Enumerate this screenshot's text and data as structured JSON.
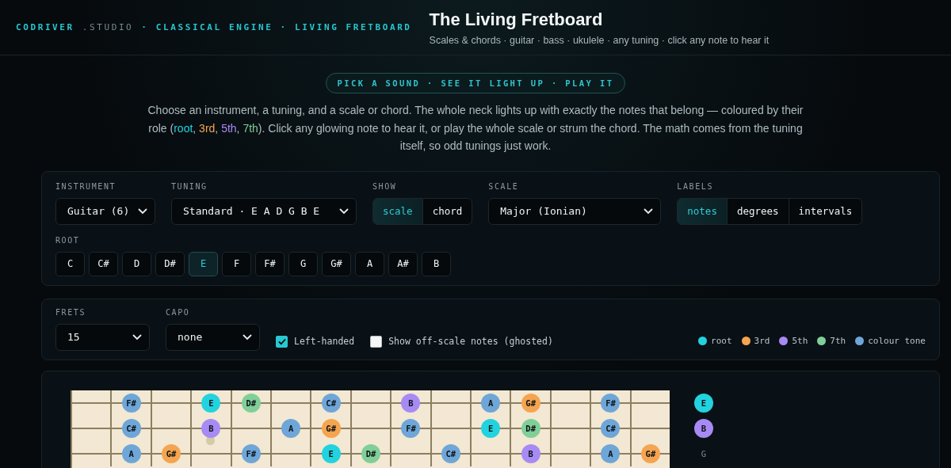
{
  "header": {
    "brand_parts": [
      {
        "text": "CODRIVER",
        "kind": "accent"
      },
      {
        "text": ".STUDIO",
        "kind": "muted"
      },
      {
        "text": "· CLASSICAL ENGINE · LIVING FRETBOARD",
        "kind": "accent"
      }
    ],
    "title": "The Living Fretboard",
    "subtitle": "Scales & chords · guitar · bass · ukulele · any tuning · click any note to hear it"
  },
  "pill": "PICK A SOUND · SEE IT LIGHT UP · PLAY IT",
  "intro": [
    {
      "text": "Choose an instrument, a tuning, and a scale or chord. The whole neck lights up with exactly the notes that belong — coloured by their role ("
    },
    {
      "text": "root",
      "color": "#22d3df"
    },
    {
      "text": ", "
    },
    {
      "text": "3rd",
      "color": "#f5a54f"
    },
    {
      "text": ", "
    },
    {
      "text": "5th",
      "color": "#a88af5"
    },
    {
      "text": ", "
    },
    {
      "text": "7th",
      "color": "#80cf98"
    },
    {
      "text": "). Click any glowing note to hear it, or play the whole scale or strum the chord. The math comes from the tuning itself, so odd tunings just work."
    }
  ],
  "controls": {
    "instrument": {
      "label": "INSTRUMENT",
      "value": "Guitar (6)"
    },
    "tuning": {
      "label": "TUNING",
      "value": "Standard · E A D G B E"
    },
    "show": {
      "label": "SHOW",
      "options": [
        {
          "label": "scale",
          "selected": true
        },
        {
          "label": "chord",
          "selected": false
        }
      ]
    },
    "scale": {
      "label": "SCALE",
      "value": "Major (Ionian)"
    },
    "labels": {
      "label": "LABELS",
      "options": [
        {
          "label": "notes",
          "selected": true
        },
        {
          "label": "degrees",
          "selected": false
        },
        {
          "label": "intervals",
          "selected": false
        }
      ]
    },
    "root": {
      "label": "ROOT",
      "options": [
        {
          "label": "C",
          "selected": false
        },
        {
          "label": "C#",
          "selected": false
        },
        {
          "label": "D",
          "selected": false
        },
        {
          "label": "D#",
          "selected": false
        },
        {
          "label": "E",
          "selected": true
        },
        {
          "label": "F",
          "selected": false
        },
        {
          "label": "F#",
          "selected": false
        },
        {
          "label": "G",
          "selected": false
        },
        {
          "label": "G#",
          "selected": false
        },
        {
          "label": "A",
          "selected": false
        },
        {
          "label": "A#",
          "selected": false
        },
        {
          "label": "B",
          "selected": false
        }
      ]
    }
  },
  "options": {
    "frets": {
      "label": "FRETS",
      "value": "15"
    },
    "capo": {
      "label": "CAPO",
      "value": "none"
    },
    "left_handed": {
      "label": "Left-handed",
      "checked": true
    },
    "show_off_scale": {
      "label": "Show off-scale notes (ghosted)",
      "checked": false
    },
    "legend": [
      {
        "label": "root",
        "color": "#22d3df"
      },
      {
        "label": "3rd",
        "color": "#f5a54f"
      },
      {
        "label": "5th",
        "color": "#a88af5"
      },
      {
        "label": "7th",
        "color": "#80cf98"
      },
      {
        "label": "colour tone",
        "color": "#6fa6d8"
      }
    ]
  },
  "fretboard": {
    "strings": [
      {
        "frets": [
          {
            "kind": "empty"
          },
          {
            "kind": "note",
            "label": "F#",
            "color": "#6fa6d8"
          },
          {
            "kind": "empty"
          },
          {
            "kind": "note",
            "label": "E",
            "color": "#22d3df"
          },
          {
            "kind": "note",
            "label": "D#",
            "color": "#80cf98"
          },
          {
            "kind": "empty"
          },
          {
            "kind": "note",
            "label": "C#",
            "color": "#6fa6d8"
          },
          {
            "kind": "empty"
          },
          {
            "kind": "note",
            "label": "B",
            "color": "#a88af5"
          },
          {
            "kind": "empty"
          },
          {
            "kind": "note",
            "label": "A",
            "color": "#6fa6d8"
          },
          {
            "kind": "note",
            "label": "G#",
            "color": "#f5a54f"
          },
          {
            "kind": "empty"
          },
          {
            "kind": "note",
            "label": "F#",
            "color": "#6fa6d8"
          },
          {
            "kind": "empty"
          }
        ],
        "open": {
          "kind": "note",
          "label": "E",
          "color": "#22d3df"
        }
      },
      {
        "frets": [
          {
            "kind": "empty"
          },
          {
            "kind": "note",
            "label": "C#",
            "color": "#6fa6d8"
          },
          {
            "kind": "empty"
          },
          {
            "kind": "note",
            "label": "B",
            "color": "#a88af5"
          },
          {
            "kind": "empty"
          },
          {
            "kind": "note",
            "label": "A",
            "color": "#6fa6d8"
          },
          {
            "kind": "note",
            "label": "G#",
            "color": "#f5a54f"
          },
          {
            "kind": "empty"
          },
          {
            "kind": "note",
            "label": "F#",
            "color": "#6fa6d8"
          },
          {
            "kind": "empty"
          },
          {
            "kind": "note",
            "label": "E",
            "color": "#22d3df"
          },
          {
            "kind": "note",
            "label": "D#",
            "color": "#80cf98"
          },
          {
            "kind": "empty"
          },
          {
            "kind": "note",
            "label": "C#",
            "color": "#6fa6d8"
          },
          {
            "kind": "empty"
          }
        ],
        "open": {
          "kind": "note",
          "label": "B",
          "color": "#a88af5"
        }
      },
      {
        "frets": [
          {
            "kind": "empty"
          },
          {
            "kind": "note",
            "label": "A",
            "color": "#6fa6d8"
          },
          {
            "kind": "note",
            "label": "G#",
            "color": "#f5a54f"
          },
          {
            "kind": "empty"
          },
          {
            "kind": "note",
            "label": "F#",
            "color": "#6fa6d8"
          },
          {
            "kind": "empty"
          },
          {
            "kind": "note",
            "label": "E",
            "color": "#22d3df"
          },
          {
            "kind": "note",
            "label": "D#",
            "color": "#80cf98"
          },
          {
            "kind": "empty"
          },
          {
            "kind": "note",
            "label": "C#",
            "color": "#6fa6d8"
          },
          {
            "kind": "empty"
          },
          {
            "kind": "note",
            "label": "B",
            "color": "#a88af5"
          },
          {
            "kind": "empty"
          },
          {
            "kind": "note",
            "label": "A",
            "color": "#6fa6d8"
          },
          {
            "kind": "note",
            "label": "G#",
            "color": "#f5a54f"
          }
        ],
        "open": {
          "kind": "plain",
          "label": "G"
        }
      }
    ]
  }
}
